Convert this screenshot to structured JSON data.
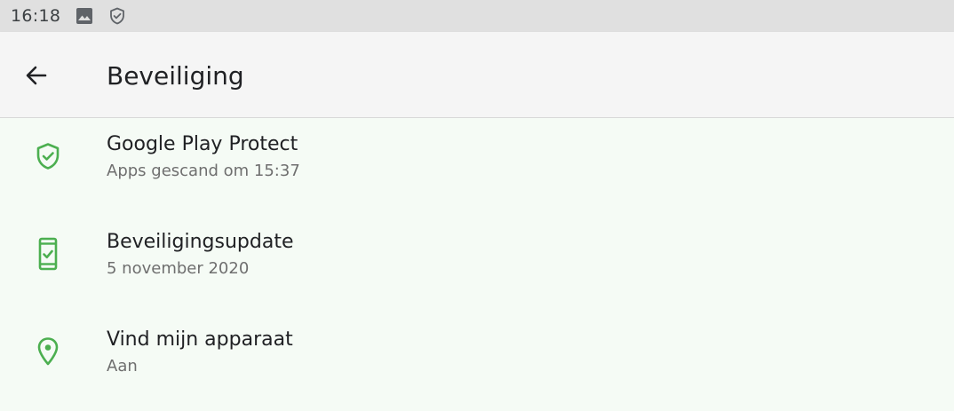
{
  "status_bar": {
    "time": "16:18",
    "icons": [
      "image-icon",
      "shield-check-icon"
    ]
  },
  "app_bar": {
    "title": "Beveiliging",
    "back_icon": "arrow-back-icon"
  },
  "colors": {
    "accent": "#4caf50",
    "background": "#f5fbf5",
    "status_bar": "#e0e0e0",
    "app_bar": "#f5f5f5"
  },
  "items": [
    {
      "title": "Google Play Protect",
      "subtitle": "Apps gescand om 15:37",
      "icon": "shield-check-icon"
    },
    {
      "title": "Beveiligingsupdate",
      "subtitle": "5 november 2020",
      "icon": "phone-check-icon"
    },
    {
      "title": "Vind mijn apparaat",
      "subtitle": "Aan",
      "icon": "location-pin-icon"
    }
  ]
}
